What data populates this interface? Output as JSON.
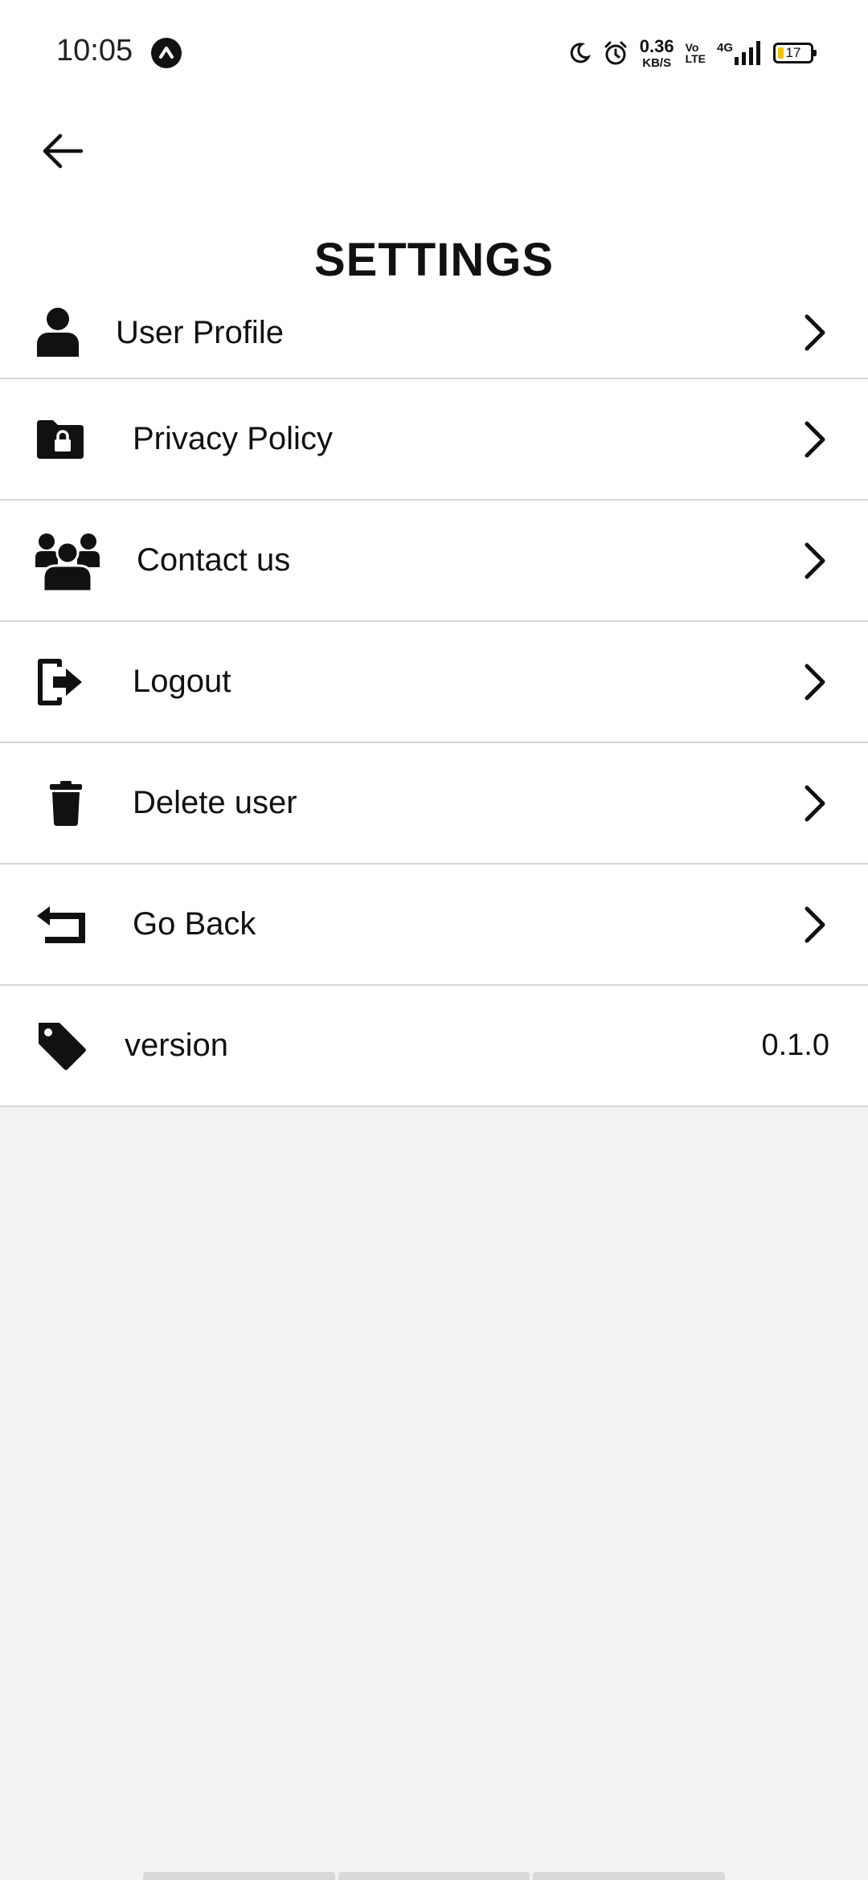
{
  "status_bar": {
    "time": "10:05",
    "net_speed_value": "0.36",
    "net_speed_unit": "KB/S",
    "volte_top": "Vo",
    "volte_bottom": "LTE",
    "network": "4G",
    "battery": "17",
    "icons": [
      "app-notification-icon",
      "do-not-disturb-moon-icon",
      "alarm-icon",
      "signal-icon",
      "battery-icon"
    ]
  },
  "app_bar": {
    "back_icon": "arrow-left-icon"
  },
  "settings": {
    "title": "SETTINGS",
    "items": [
      {
        "label": "User Profile",
        "icon": "user-icon"
      },
      {
        "label": "Privacy Policy",
        "icon": "folder-lock-icon"
      },
      {
        "label": "Contact us",
        "icon": "users-group-icon"
      },
      {
        "label": "Logout",
        "icon": "logout-icon"
      },
      {
        "label": "Delete user",
        "icon": "trash-icon"
      },
      {
        "label": "Go Back",
        "icon": "return-arrow-icon"
      }
    ],
    "version": {
      "label": "version",
      "value": "0.1.0",
      "icon": "tag-icon"
    }
  },
  "colors": {
    "background": "#f2f2f2",
    "surface": "#ffffff",
    "divider": "#d6d6d6",
    "text": "#111111",
    "battery_fill": "#f2c200"
  }
}
